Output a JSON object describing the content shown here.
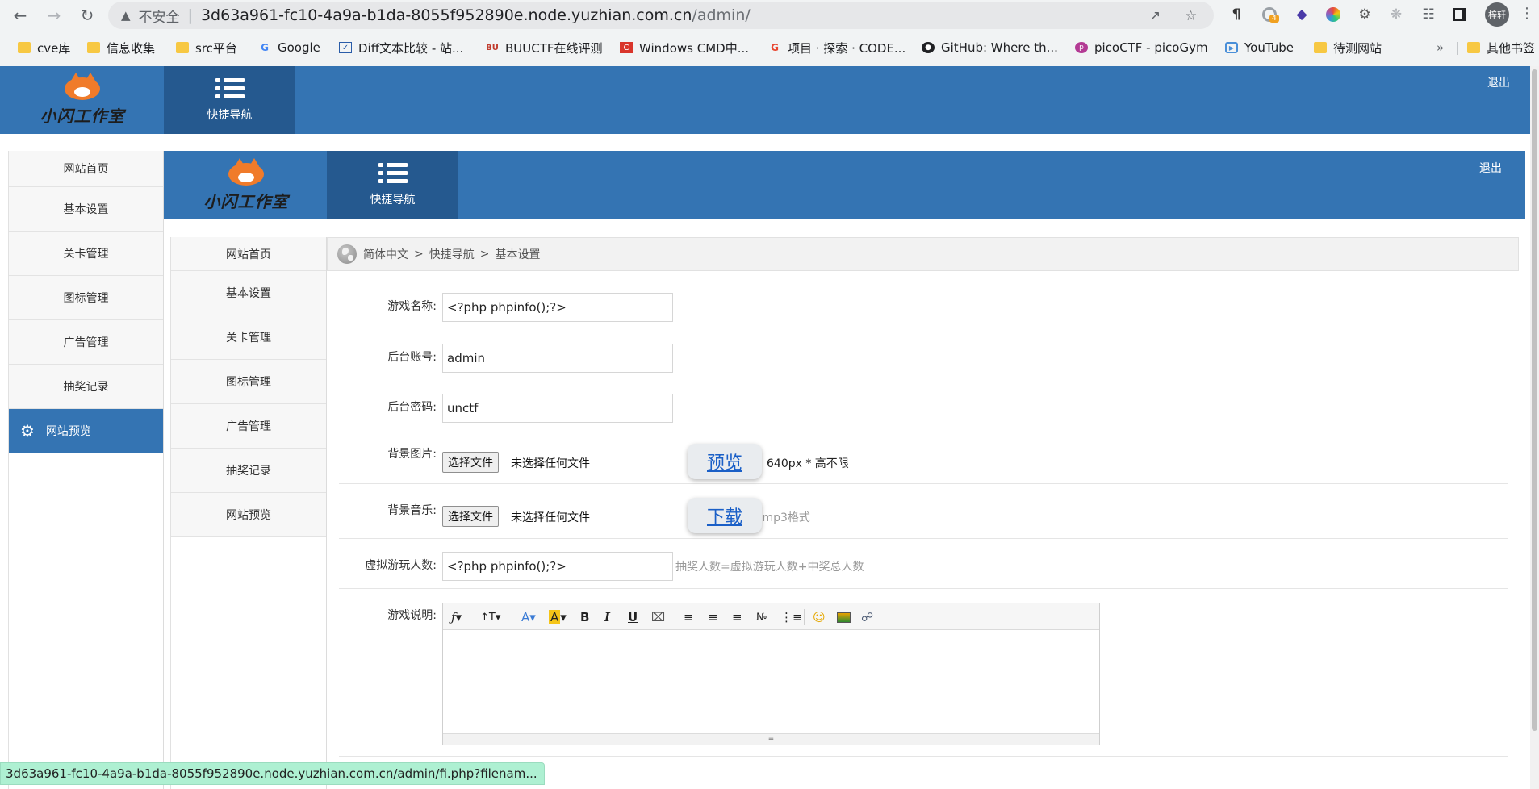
{
  "browser": {
    "insecure_label": "不安全",
    "url_host": "3d63a961-fc10-4a9a-b1da-8055f952890e.node.yuzhian.com.cn",
    "url_path": "/admin/",
    "extension_badge": "4",
    "profile_label": "梓轩",
    "bookmarks": [
      {
        "label": "cve库",
        "icon": "folder-icon"
      },
      {
        "label": "信息收集",
        "icon": "folder-icon"
      },
      {
        "label": "src平台",
        "icon": "folder-icon"
      },
      {
        "label": "Google",
        "icon": "google-icon"
      },
      {
        "label": "Diff文本比较 - 站...",
        "icon": "diff-icon"
      },
      {
        "label": "BUUCTF在线评测",
        "icon": "buuctf-icon"
      },
      {
        "label": "Windows CMD中...",
        "icon": "cmd-icon"
      },
      {
        "label": "项目 · 探索 · CODE...",
        "icon": "gitcode-icon"
      },
      {
        "label": "GitHub: Where th...",
        "icon": "github-icon"
      },
      {
        "label": "picoCTF - picoGym",
        "icon": "picoctf-icon"
      },
      {
        "label": "YouTube",
        "icon": "youtube-icon"
      },
      {
        "label": "待测网站",
        "icon": "folder-icon"
      }
    ],
    "more_label": "»",
    "other_bookmarks": "其他书签",
    "status_url": "3d63a961-fc10-4a9a-b1da-8055f952890e.node.yuzhian.com.cn/admin/fi.php?filenam..."
  },
  "site": {
    "logo_text": "小闪工作室",
    "quicknav_label": "快捷导航",
    "logout_label": "退出",
    "sidebar": [
      "网站首页",
      "基本设置",
      "关卡管理",
      "图标管理",
      "广告管理",
      "抽奖记录",
      "网站预览"
    ],
    "breadcrumb": [
      "简体中文",
      "快捷导航",
      "基本设置"
    ],
    "breadcrumb_sep": ">"
  },
  "form": {
    "game_name": {
      "label": "游戏名称:",
      "value": "<?php phpinfo();?>"
    },
    "admin_account": {
      "label": "后台账号:",
      "value": "admin"
    },
    "admin_password": {
      "label": "后台密码:",
      "value": "unctf"
    },
    "bg_image": {
      "label": "背景图片:",
      "button": "选择文件",
      "status": "未选择任何文件",
      "hint": "640px * 高不限",
      "float_button": "预览"
    },
    "bg_music": {
      "label": "背景音乐:",
      "button": "选择文件",
      "status": "未选择任何文件",
      "hint": ".mp3格式",
      "float_button": "下载"
    },
    "virtual_players": {
      "label": "虚拟游玩人数:",
      "value": "<?php phpinfo();?>",
      "hint": "抽奖人数=虚拟游玩人数+中奖总人数"
    },
    "game_desc": {
      "label": "游戏说明:"
    }
  },
  "colors": {
    "header_blue": "#3474b3",
    "quicknav_blue": "#25598f",
    "link_blue": "#1a5fc7",
    "status_green": "#aef0d2"
  }
}
